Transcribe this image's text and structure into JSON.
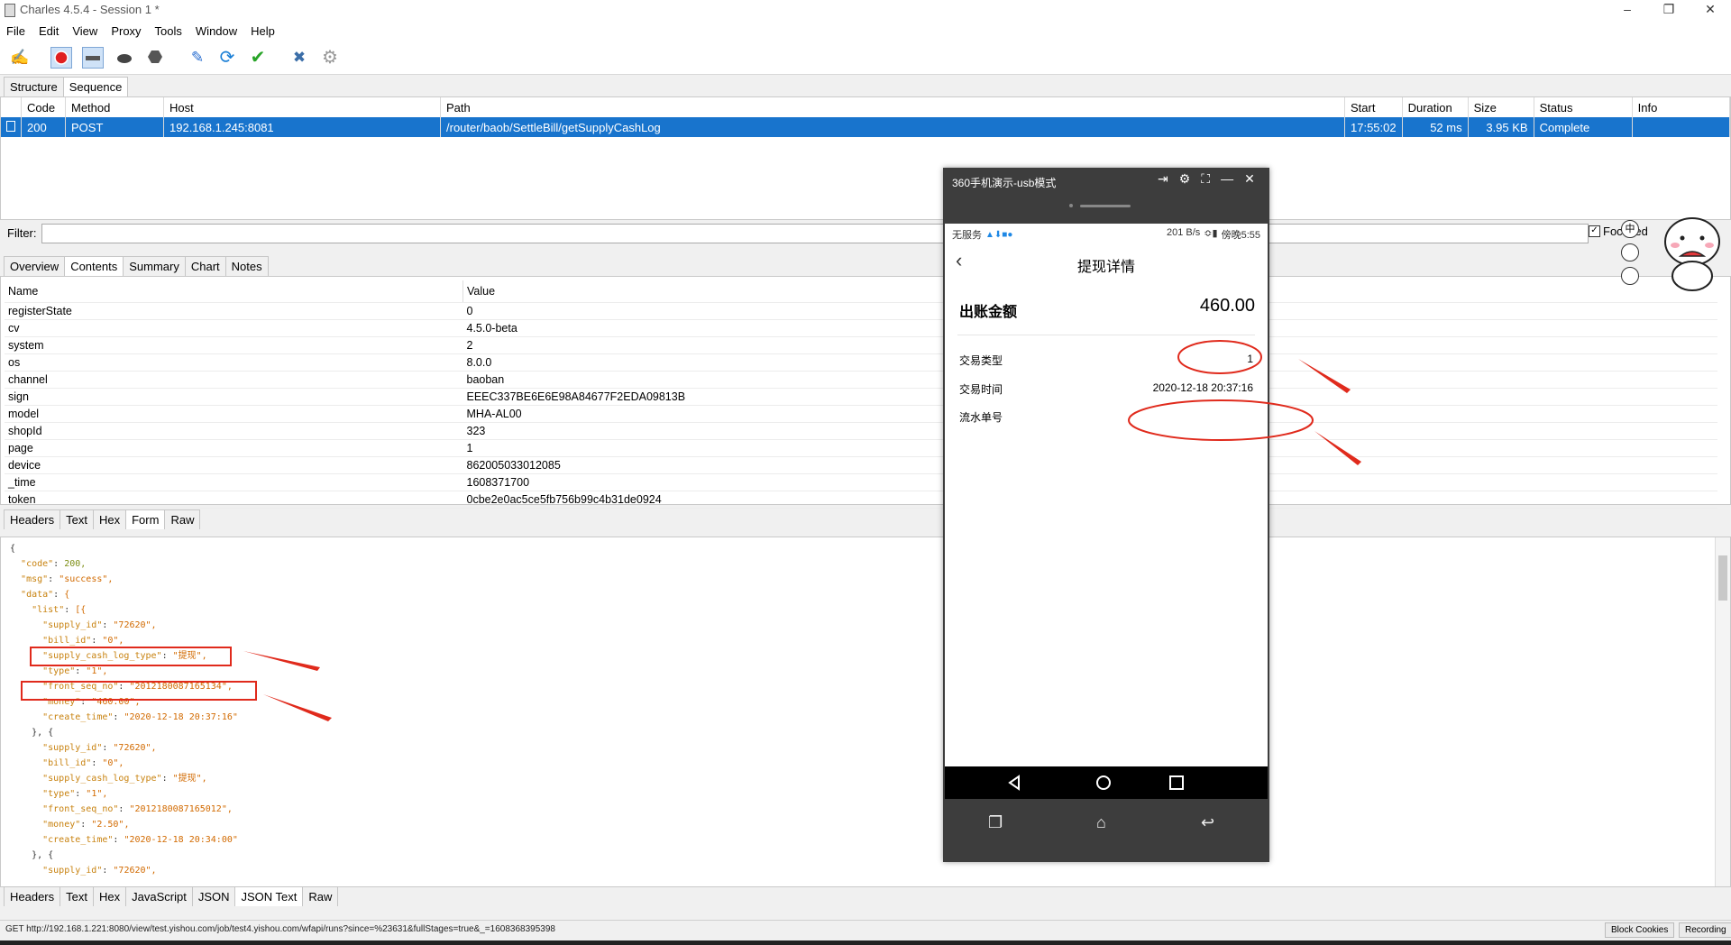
{
  "app": {
    "title": "Charles 4.5.4 - Session 1 *",
    "menu": [
      "File",
      "Edit",
      "View",
      "Proxy",
      "Tools",
      "Window",
      "Help"
    ]
  },
  "toolbar": {
    "icons": [
      "broom-icon",
      "record-icon",
      "throttle-icon",
      "turtle-icon",
      "stop-icon",
      "pen-icon",
      "refresh-icon",
      "check-icon",
      "tools-icon",
      "gear-icon"
    ]
  },
  "view_tabs": [
    "Structure",
    "Sequence"
  ],
  "sequence": {
    "columns": [
      "Code",
      "Method",
      "Host",
      "Path",
      "Start",
      "Duration",
      "Size",
      "Status",
      "Info"
    ],
    "rows": [
      {
        "code": "200",
        "method": "POST",
        "host": "192.168.1.245:8081",
        "path": "/router/baob/SettleBill/getSupplyCashLog",
        "start": "17:55:02",
        "duration": "52 ms",
        "size": "3.95 KB",
        "status": "Complete",
        "info": ""
      }
    ]
  },
  "filter": {
    "label": "Filter:",
    "value": "",
    "focused_label": "Focused"
  },
  "detail_tabs": [
    "Overview",
    "Contents",
    "Summary",
    "Chart",
    "Notes"
  ],
  "form": {
    "header": [
      "Name",
      "Value"
    ],
    "rows": [
      [
        "registerState",
        "0"
      ],
      [
        "cv",
        "4.5.0-beta"
      ],
      [
        "system",
        "2"
      ],
      [
        "os",
        "8.0.0"
      ],
      [
        "channel",
        "baoban"
      ],
      [
        "sign",
        "EEEC337BE6E6E98A84677F2EDA09813B"
      ],
      [
        "model",
        "MHA-AL00"
      ],
      [
        "shopId",
        "323"
      ],
      [
        "page",
        "1"
      ],
      [
        "device",
        "862005033012085"
      ],
      [
        "_time",
        "1608371700"
      ],
      [
        "token",
        "0cbe2e0ac5ce5fb756b99c4b31de0924"
      ]
    ]
  },
  "request_tabs": [
    "Headers",
    "Text",
    "Hex",
    "Form",
    "Raw"
  ],
  "response_tabs": [
    "Headers",
    "Text",
    "Hex",
    "JavaScript",
    "JSON",
    "JSON Text",
    "Raw"
  ],
  "json_lines": [
    "{",
    "  \"code\": 200,",
    "  \"msg\": \"success\",",
    "  \"data\": {",
    "    \"list\": [{",
    "      \"supply_id\": \"72620\",",
    "      \"bill_id\": \"0\",",
    "      \"supply_cash_log_type\": \"提现\",",
    "      \"type\": \"1\",",
    "      \"front_seq_no\": \"2012180087165134\",",
    "      \"money\": \"460.00\",",
    "      \"create_time\": \"2020-12-18 20:37:16\"",
    "    }, {",
    "      \"supply_id\": \"72620\",",
    "      \"bill_id\": \"0\",",
    "      \"supply_cash_log_type\": \"提现\",",
    "      \"type\": \"1\",",
    "      \"front_seq_no\": \"2012180087165012\",",
    "      \"money\": \"2.50\",",
    "      \"create_time\": \"2020-12-18 20:34:00\"",
    "    }, {",
    "      \"supply_id\": \"72620\","
  ],
  "statusbar": {
    "text": "GET http://192.168.1.221:8080/view/test.yishou.com/job/test4.yishou.com/wfapi/runs?since=%23631&fullStages=true&_=1608368395398",
    "block_cookies": "Block Cookies",
    "recording": "Recording"
  },
  "phone_window": {
    "title": "360手机演示-usb模式",
    "status_left": "无服务",
    "status_right": "201 B/s",
    "status_time": "傍晚5:55",
    "page_title": "提现详情",
    "amount_label": "出账金额",
    "amount_value": "460.00",
    "rows": [
      {
        "label": "交易类型",
        "value": "1"
      },
      {
        "label": "交易时间",
        "value": "2020-12-18 20:37:16"
      },
      {
        "label": "流水单号",
        "value": ""
      }
    ]
  },
  "colors": {
    "selection": "#1874cd",
    "annotation": "#e02a1c",
    "phone_dark": "#3d3d3d"
  }
}
